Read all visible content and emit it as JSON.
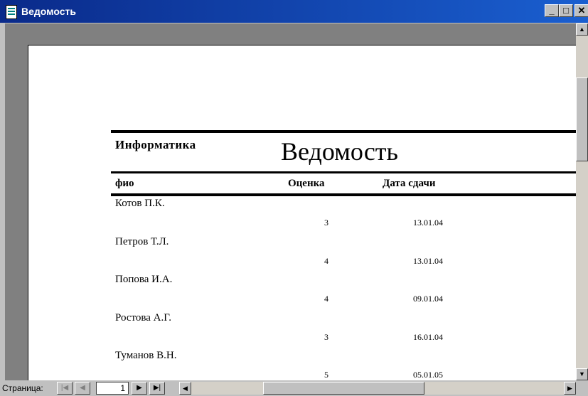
{
  "window": {
    "title": "Ведомость",
    "minimize_glyph": "_",
    "maximize_glyph": "□",
    "close_glyph": "✕"
  },
  "report": {
    "subject": "Информатика",
    "title": "Ведомость",
    "headers": {
      "name": "фио",
      "grade": "Оценка",
      "date": "Дата сдачи"
    },
    "records": [
      {
        "name": "Котов П.К.",
        "grade": "3",
        "date": "13.01.04"
      },
      {
        "name": "Петров Т.Л.",
        "grade": "4",
        "date": "13.01.04"
      },
      {
        "name": "Попова И.А.",
        "grade": "4",
        "date": "09.01.04"
      },
      {
        "name": "Ростова А.Г.",
        "grade": "3",
        "date": "16.01.04"
      },
      {
        "name": "Туманов В.Н.",
        "grade": "5",
        "date": "05.01.05"
      }
    ]
  },
  "navigation": {
    "page_label": "Страница:",
    "current_page": "1",
    "first_glyph": "|◀",
    "prev_glyph": "◀",
    "next_glyph": "▶",
    "last_glyph": "▶|"
  },
  "scrollbars": {
    "up_glyph": "▲",
    "down_glyph": "▼",
    "left_glyph": "◀",
    "right_glyph": "▶"
  }
}
